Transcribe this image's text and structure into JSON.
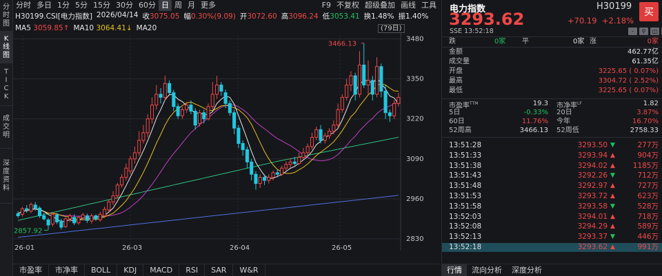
{
  "vtabs": [
    {
      "lines": [
        "分",
        "时",
        "图"
      ],
      "active": false
    },
    {
      "lines": [
        "K",
        "线",
        "图"
      ],
      "active": true
    },
    {
      "lines": [
        "T",
        "I",
        "C",
        "K"
      ],
      "active": false
    },
    {
      "lines": [
        "成",
        "交",
        "明"
      ],
      "active": false
    },
    {
      "lines": [
        "深",
        "度",
        "资",
        "料"
      ],
      "active": false
    }
  ],
  "periods": [
    "分时",
    "多日",
    "1分",
    "5分",
    "15分",
    "30分",
    "60分",
    "日",
    "周",
    "月",
    "更多"
  ],
  "active_period": "日",
  "period_right": [
    "F9",
    "不复权",
    "超级叠加",
    "画线",
    "工具"
  ],
  "info": {
    "name": "H30199.CSI[电力指数]",
    "date": "2026/04/14",
    "close_label": "收",
    "close": "3075.05",
    "amp_label": "幅",
    "amp": "0.30%(9.09)",
    "open_label": "开",
    "open": "3072.60",
    "high_label": "高",
    "high": "3096.24",
    "low_label": "低",
    "low": "3053.41",
    "turn_label": "换",
    "turn": "1.48%",
    "vib_label": "振",
    "vib": "1.40%"
  },
  "ma": {
    "ma5_label": "MA5",
    "ma5": "3059.85↑",
    "ma10_label": "MA10",
    "ma10": "3064.41↓",
    "ma20_label": "MA20"
  },
  "days_label": "(79日)",
  "chart_data": {
    "type": "candlestick",
    "title": "",
    "x_ticks": [
      "26-01",
      "26-03",
      "26-04",
      "26-05"
    ],
    "y_ticks": [
      3480,
      3350,
      3220,
      3090,
      2960,
      2830
    ],
    "ylim": [
      2810,
      3490
    ],
    "max_label": "3466.13",
    "min_label": "2857.92",
    "candles": [
      [
        2905,
        2912,
        2898,
        2920,
        0
      ],
      [
        2910,
        2928,
        2902,
        2934,
        1
      ],
      [
        2928,
        2924,
        2915,
        2940,
        0
      ],
      [
        2920,
        2942,
        2914,
        2948,
        1
      ],
      [
        2940,
        2930,
        2922,
        2950,
        0
      ],
      [
        2930,
        2905,
        2898,
        2936,
        0
      ],
      [
        2905,
        2895,
        2890,
        2915,
        0
      ],
      [
        2892,
        2875,
        2860,
        2898,
        0
      ],
      [
        2878,
        2910,
        2870,
        2916,
        1
      ],
      [
        2908,
        2885,
        2878,
        2914,
        0
      ],
      [
        2888,
        2868,
        2860,
        2895,
        0
      ],
      [
        2870,
        2895,
        2866,
        2900,
        1
      ],
      [
        2895,
        2905,
        2885,
        2912,
        1
      ],
      [
        2900,
        2882,
        2875,
        2910,
        0
      ],
      [
        2882,
        2900,
        2876,
        2905,
        1
      ],
      [
        2898,
        2908,
        2890,
        2915,
        1
      ],
      [
        2905,
        2890,
        2882,
        2912,
        0
      ],
      [
        2888,
        2905,
        2880,
        2912,
        1
      ],
      [
        2905,
        2895,
        2888,
        2910,
        0
      ],
      [
        2892,
        2910,
        2886,
        2918,
        1
      ],
      [
        2905,
        2926,
        2898,
        2935,
        1
      ],
      [
        2924,
        2950,
        2918,
        2956,
        1
      ],
      [
        2950,
        2970,
        2940,
        2985,
        1
      ],
      [
        2970,
        3005,
        2960,
        3012,
        1
      ],
      [
        3005,
        3030,
        2996,
        3040,
        1
      ],
      [
        3030,
        3060,
        3020,
        3075,
        1
      ],
      [
        3050,
        3090,
        3040,
        3100,
        1
      ],
      [
        3090,
        3110,
        3075,
        3130,
        1
      ],
      [
        3110,
        3150,
        3100,
        3180,
        1
      ],
      [
        3150,
        3175,
        3140,
        3200,
        1
      ],
      [
        3175,
        3220,
        3160,
        3235,
        1
      ],
      [
        3220,
        3265,
        3205,
        3290,
        1
      ],
      [
        3265,
        3300,
        3250,
        3330,
        1
      ],
      [
        3300,
        3290,
        3270,
        3320,
        0
      ],
      [
        3290,
        3335,
        3280,
        3360,
        1
      ],
      [
        3335,
        3305,
        3295,
        3345,
        0
      ],
      [
        3305,
        3260,
        3245,
        3315,
        0
      ],
      [
        3260,
        3230,
        3220,
        3270,
        0
      ],
      [
        3230,
        3250,
        3220,
        3260,
        1
      ],
      [
        3250,
        3265,
        3240,
        3275,
        1
      ],
      [
        3265,
        3245,
        3235,
        3280,
        0
      ],
      [
        3245,
        3200,
        3185,
        3255,
        0
      ],
      [
        3205,
        3240,
        3195,
        3250,
        1
      ],
      [
        3240,
        3220,
        3205,
        3250,
        0
      ],
      [
        3220,
        3260,
        3215,
        3270,
        1
      ],
      [
        3260,
        3300,
        3250,
        3340,
        1
      ],
      [
        3300,
        3330,
        3285,
        3360,
        1
      ],
      [
        3330,
        3310,
        3295,
        3340,
        0
      ],
      [
        3305,
        3270,
        3255,
        3315,
        0
      ],
      [
        3270,
        3240,
        3230,
        3280,
        0
      ],
      [
        3240,
        3190,
        3170,
        3250,
        0
      ],
      [
        3190,
        3140,
        3125,
        3200,
        0
      ],
      [
        3140,
        3120,
        3100,
        3150,
        0
      ],
      [
        3120,
        3080,
        3060,
        3130,
        0
      ],
      [
        3080,
        3040,
        3020,
        3090,
        0
      ],
      [
        3040,
        3010,
        2990,
        3050,
        0
      ],
      [
        3010,
        3030,
        2996,
        3040,
        1
      ],
      [
        3030,
        3020,
        3005,
        3040,
        0
      ],
      [
        3020,
        3030,
        3010,
        3040,
        1
      ],
      [
        3030,
        3045,
        3020,
        3052,
        1
      ],
      [
        3045,
        3040,
        3030,
        3055,
        0
      ],
      [
        3040,
        3060,
        3035,
        3068,
        1
      ],
      [
        3060,
        3072,
        3050,
        3082,
        1
      ],
      [
        3072,
        3080,
        3062,
        3092,
        1
      ],
      [
        3080,
        3075,
        3068,
        3096,
        0
      ],
      [
        3075,
        3095,
        3070,
        3110,
        1
      ],
      [
        3095,
        3110,
        3088,
        3125,
        1
      ],
      [
        3110,
        3130,
        3100,
        3140,
        1
      ],
      [
        3130,
        3160,
        3120,
        3175,
        1
      ],
      [
        3160,
        3185,
        3150,
        3195,
        1
      ],
      [
        3185,
        3150,
        3140,
        3200,
        0
      ],
      [
        3150,
        3165,
        3140,
        3175,
        1
      ],
      [
        3165,
        3180,
        3155,
        3190,
        1
      ],
      [
        3180,
        3200,
        3170,
        3215,
        1
      ],
      [
        3200,
        3250,
        3190,
        3270,
        1
      ],
      [
        3250,
        3290,
        3240,
        3300,
        1
      ],
      [
        3290,
        3330,
        3280,
        3350,
        1
      ],
      [
        3330,
        3360,
        3310,
        3375,
        1
      ],
      [
        3360,
        3300,
        3280,
        3370,
        0
      ],
      [
        3300,
        3395,
        3290,
        3440,
        1
      ],
      [
        3395,
        3330,
        3320,
        3466,
        0
      ],
      [
        3330,
        3345,
        3300,
        3410,
        1
      ],
      [
        3345,
        3300,
        3280,
        3360,
        0
      ],
      [
        3300,
        3390,
        3290,
        3420,
        1
      ],
      [
        3390,
        3310,
        3290,
        3400,
        0
      ],
      [
        3310,
        3240,
        3220,
        3330,
        0
      ],
      [
        3240,
        3230,
        3210,
        3250,
        0
      ],
      [
        3230,
        3270,
        3220,
        3280,
        1
      ],
      [
        3270,
        3290,
        3260,
        3305,
        1
      ]
    ]
  },
  "right": {
    "name": "电力指数",
    "code": "H30199",
    "buy": "买",
    "price": "3293.62",
    "change": "+70.19",
    "change_pct": "+2.18%",
    "sub": "SSE  13:52:18",
    "icons": [
      "-",
      "⚲",
      "◫",
      "⚑"
    ],
    "breadth": {
      "down_label": "跌",
      "down": "0家",
      "flat_label": "平",
      "flat": "0家",
      "up_label": "涨",
      "up": "0家"
    },
    "stats": [
      {
        "label": "金额",
        "value": "462.77亿",
        "color": "white"
      },
      {
        "label": "成交量",
        "value": "61.35亿",
        "color": "white"
      },
      {
        "label": "开盘",
        "value": "3225.65 ( 0.07%)",
        "color": "red"
      },
      {
        "label": "最高",
        "value": "3304.72 ( 2.52%)",
        "color": "red"
      },
      {
        "label": "最低",
        "value": "3225.65 ( 0.07%)",
        "color": "red"
      }
    ],
    "pe_label": "市盈率",
    "pe_sup": "TTM",
    "pe": "19.3",
    "pb_label": "市净率",
    "pb_sup": "LF",
    "pb": "1.82",
    "d5_label": "5日",
    "d5": "-0.33%",
    "d20_label": "20日",
    "d20": "3.87%",
    "d60_label": "60日",
    "d60": "11.76%",
    "ytd_label": "今年",
    "ytd": "16.70%",
    "w52h_label": "52周高",
    "w52h": "3466.13",
    "w52l_label": "52周低",
    "w52l": "2758.33",
    "ticks": [
      {
        "time": "13:51:28",
        "price": "3293.50",
        "dir": "down",
        "vol": "277万"
      },
      {
        "time": "13:51:33",
        "price": "3293.94",
        "dir": "up",
        "vol": "904万"
      },
      {
        "time": "13:51:38",
        "price": "3294.02",
        "dir": "up",
        "vol": "1185万"
      },
      {
        "time": "13:51:43",
        "price": "3292.26",
        "dir": "down",
        "vol": "712万"
      },
      {
        "time": "13:51:48",
        "price": "3292.97",
        "dir": "up",
        "vol": "727万"
      },
      {
        "time": "13:51:53",
        "price": "3293.72",
        "dir": "up",
        "vol": "623万"
      },
      {
        "time": "13:51:58",
        "price": "3293.58",
        "dir": "down",
        "vol": "528万"
      },
      {
        "time": "13:52:03",
        "price": "3294.01",
        "dir": "up",
        "vol": "718万"
      },
      {
        "time": "13:52:08",
        "price": "3294.29",
        "dir": "up",
        "vol": "589万"
      },
      {
        "time": "13:52:13",
        "price": "3293.37",
        "dir": "down",
        "vol": "446万"
      },
      {
        "time": "13:52:18",
        "price": "3293.62",
        "dir": "up",
        "vol": "991万"
      }
    ],
    "tabs": [
      "行情",
      "流向分析",
      "深度分析"
    ]
  },
  "btabs": [
    "市盈率",
    "市净率",
    "BOLL",
    "KDJ",
    "MACD",
    "RSI",
    "SAR",
    "W&R"
  ],
  "colors": {
    "up": "#f04848",
    "down": "#20c8e0",
    "ma5": "#e8e8e8",
    "ma10": "#e8c020",
    "ma20": "#c040c0",
    "ma60": "#30c080",
    "ma120": "#5070e0",
    "highlight_row": "#1f4d5a"
  }
}
